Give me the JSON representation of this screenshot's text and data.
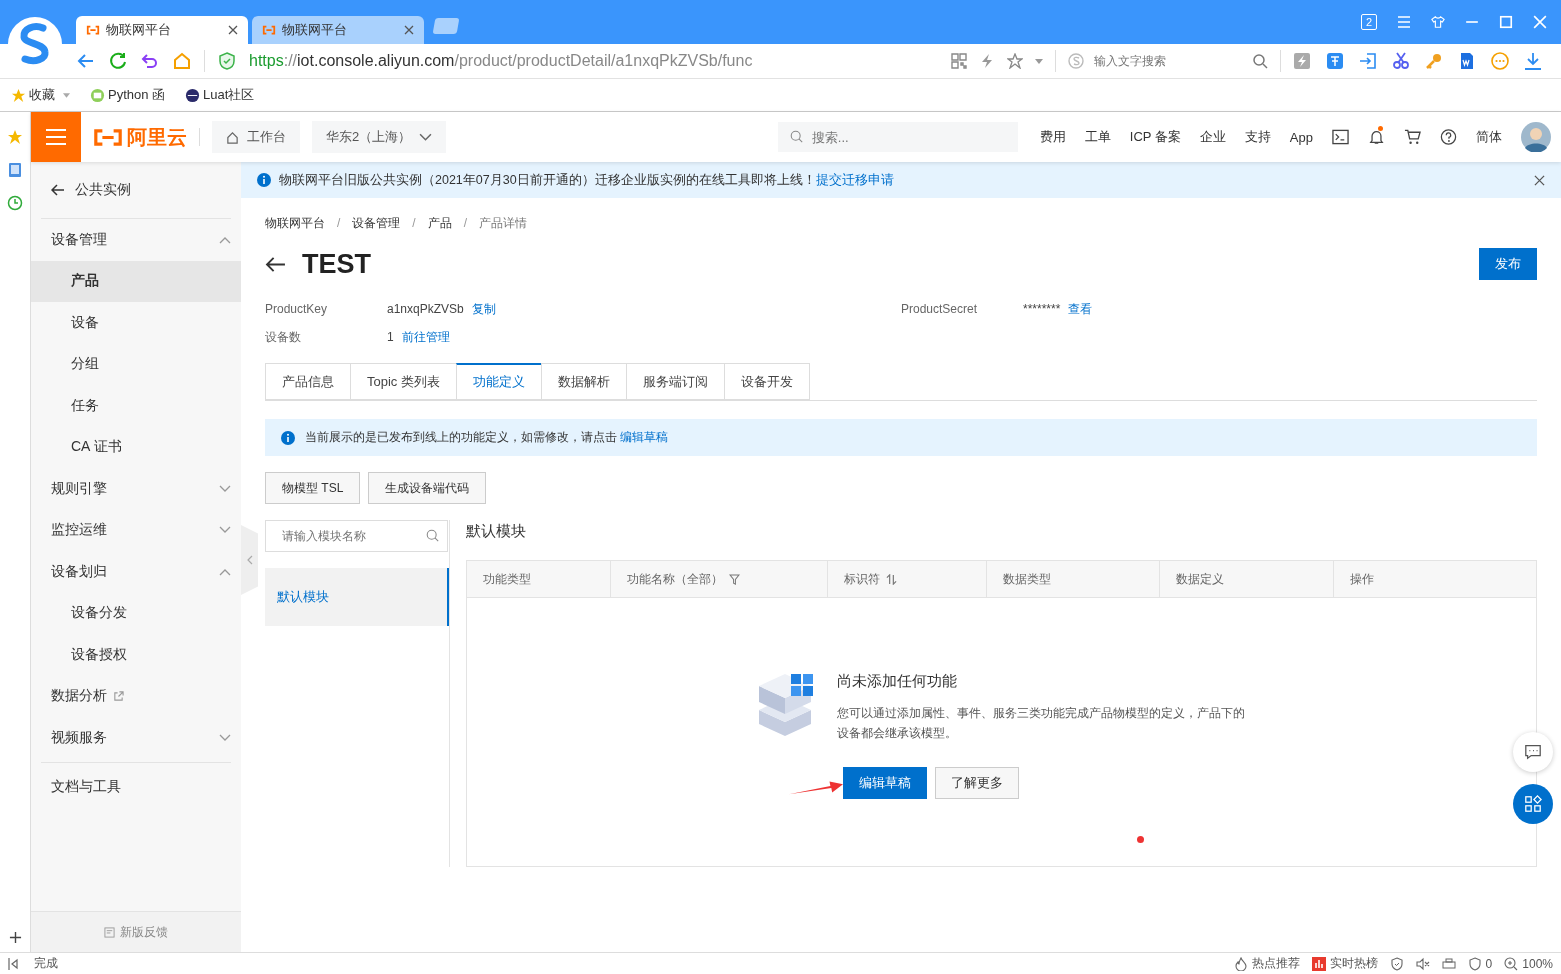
{
  "browser": {
    "tabs": [
      {
        "label": "物联网平台",
        "selected": true
      },
      {
        "label": "物联网平台",
        "selected": false
      }
    ],
    "window_badge": "2",
    "url": [
      {
        "text": "https",
        "kind": "scheme"
      },
      {
        "text": "://",
        "kind": "sep"
      },
      {
        "text": "iot.console.aliyun.com",
        "kind": "host"
      },
      {
        "text": "/product/productDetail/a1nxqPkZVSb/func",
        "kind": "path"
      }
    ],
    "search_placeholder": "输入文字搜索",
    "bookmarks": [
      {
        "label": "收藏",
        "kind": "star"
      },
      {
        "label": "Python 函",
        "kind": "python"
      },
      {
        "label": "Luat社区",
        "kind": "luat"
      }
    ]
  },
  "header": {
    "logo": "阿里云",
    "workbench": "工作台",
    "region": "华东2（上海）",
    "search_placeholder": "搜索...",
    "links": [
      "费用",
      "工单",
      "ICP 备案",
      "企业",
      "支持",
      "App"
    ],
    "unread": true,
    "language": "简体"
  },
  "sidebar": {
    "back": "公共实例",
    "groups": [
      {
        "label": "设备管理",
        "kind": "group",
        "expanded": true,
        "children": [
          {
            "label": "产品",
            "selected": true
          },
          {
            "label": "设备",
            "selected": false
          },
          {
            "label": "分组",
            "selected": false
          },
          {
            "label": "任务",
            "selected": false
          },
          {
            "label": "CA 证书",
            "selected": false
          }
        ]
      },
      {
        "label": "规则引擎",
        "kind": "group",
        "expanded": false
      },
      {
        "label": "监控运维",
        "kind": "group",
        "expanded": false
      },
      {
        "label": "设备划归",
        "kind": "group",
        "expanded": true,
        "children": [
          {
            "label": "设备分发",
            "selected": false
          },
          {
            "label": "设备授权",
            "selected": false
          }
        ]
      },
      {
        "label": "数据分析",
        "kind": "external"
      },
      {
        "label": "视频服务",
        "kind": "group",
        "expanded": false
      }
    ],
    "extra": "文档与工具",
    "feedback": "新版反馈"
  },
  "notice": {
    "text": "物联网平台旧版公共实例（2021年07月30日前开通的）迁移企业版实例的在线工具即将上线！",
    "link": "提交迁移申请"
  },
  "breadcrumbs": {
    "separator": "/",
    "items": [
      "物联网平台",
      "设备管理",
      "产品",
      "产品详情"
    ]
  },
  "product": {
    "title": "TEST",
    "publish": "发布",
    "fields": [
      {
        "label": "ProductKey",
        "value": "a1nxqPkZVSb",
        "action": "复制"
      },
      {
        "label": "ProductSecret",
        "value": "********",
        "action": "查看"
      },
      {
        "label": "设备数",
        "value": "1",
        "action": "前往管理"
      }
    ]
  },
  "tabs": [
    {
      "label": "产品信息",
      "selected": false
    },
    {
      "label": "Topic 类列表",
      "selected": false
    },
    {
      "label": "功能定义",
      "selected": true
    },
    {
      "label": "数据解析",
      "selected": false
    },
    {
      "label": "服务端订阅",
      "selected": false
    },
    {
      "label": "设备开发",
      "selected": false
    }
  ],
  "alert": {
    "text": "当前展示的是已发布到线上的功能定义，如需修改，请点击",
    "link": "编辑草稿"
  },
  "toolbar": [
    "物模型 TSL",
    "生成设备端代码"
  ],
  "modules": {
    "search_placeholder": "请输入模块名称",
    "items": [
      {
        "label": "默认模块",
        "selected": true
      }
    ],
    "heading": "默认模块"
  },
  "table": {
    "columns": [
      {
        "label": "功能类型",
        "kind": "plain"
      },
      {
        "label": "功能名称（全部）",
        "kind": "filter"
      },
      {
        "label": "标识符",
        "kind": "sort"
      },
      {
        "label": "数据类型",
        "kind": "plain"
      },
      {
        "label": "数据定义",
        "kind": "plain"
      },
      {
        "label": "操作",
        "kind": "plain"
      }
    ]
  },
  "empty": {
    "title": "尚未添加任何功能",
    "description": "您可以通过添加属性、事件、服务三类功能完成产品物模型的定义，产品下的设备都会继承该模型。",
    "primary": "编辑草稿",
    "secondary": "了解更多"
  },
  "status_bar": {
    "text": "完成",
    "hot": "热点推荐",
    "trending": "实时热榜",
    "count": "0",
    "zoom": "100%"
  }
}
